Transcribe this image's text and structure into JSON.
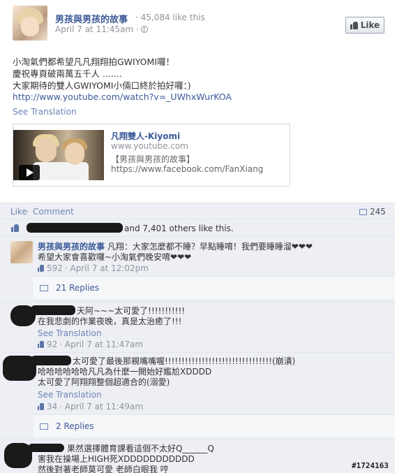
{
  "post": {
    "page_name": "男孩與男孩的故事",
    "likes_count": "· 45,084 like this",
    "time": "April 7 at 11:45am ·",
    "like_button": "Like",
    "text_line1": "小淘氣們都希望凡凡翔翔拍GWIYOMI囉！",
    "text_line2": "慶祝專頁破兩萬五千人 .......",
    "text_line3": "大家期待的雙人GWIYOMI小倆口終於拍好囉：)",
    "link": "http://www.youtube.com/watch?v=_UWhxWurKOA",
    "see_translation": "See Translation",
    "share": {
      "title": "凡翔雙人-Kiyomi",
      "domain": "www.youtube.com",
      "desc1": "【男孩與男孩的故事】",
      "desc2": "https://www.facebook.com/FanXiang"
    }
  },
  "ufi": {
    "like_label": "Like",
    "separator": "·",
    "comment_label": "Comment",
    "comment_count": "245",
    "likes_summary": "and 7,401 others like this."
  },
  "comments": [
    {
      "name": "男孩與男孩的故事",
      "text1": " 凡翔：大家怎麼都不睡？早點睡唷！我們要睡睡溜❤❤❤",
      "text2": "希望大家會喜歡囉~小淘氣們晚安唷❤❤❤",
      "likes": "592",
      "time": "· April 7 at 12:02pm",
      "replies": "21 Replies"
    },
    {
      "text1": "天阿~~~太可愛了!!!!!!!!!!!",
      "text2": "在我悲劇的作業夜晚，真是太治癒了!!!",
      "see_translation": "See Translation",
      "likes": "92",
      "time": "· April 7 at 11:47am"
    },
    {
      "text1": "太可愛了最後那親嘴嘴喔!!!!!!!!!!!!!!!!!!!!!!!!!!!!!!!!(崩潰)",
      "text2": "哈哈哈哈哈哈凡凡為什麼一開始好尷尬XDDDD",
      "text3": "太可愛了阿翔翔整個超適合的(溺愛)",
      "see_translation": "See Translation",
      "likes": "34",
      "time": "· April 7 at 11:49am",
      "replies": "2 Replies"
    },
    {
      "text1": "果然選擇體育課看這個不太好Q______Q",
      "text2": "害我在操場上HIGH死XDDDDDDDDDDD",
      "text3": "然後對著老師莫可愛 老師白眼我 哼"
    }
  ],
  "watermark": "#1724163",
  "colors": {
    "link": "#3b5998",
    "ufi_background": "#edeff4"
  }
}
